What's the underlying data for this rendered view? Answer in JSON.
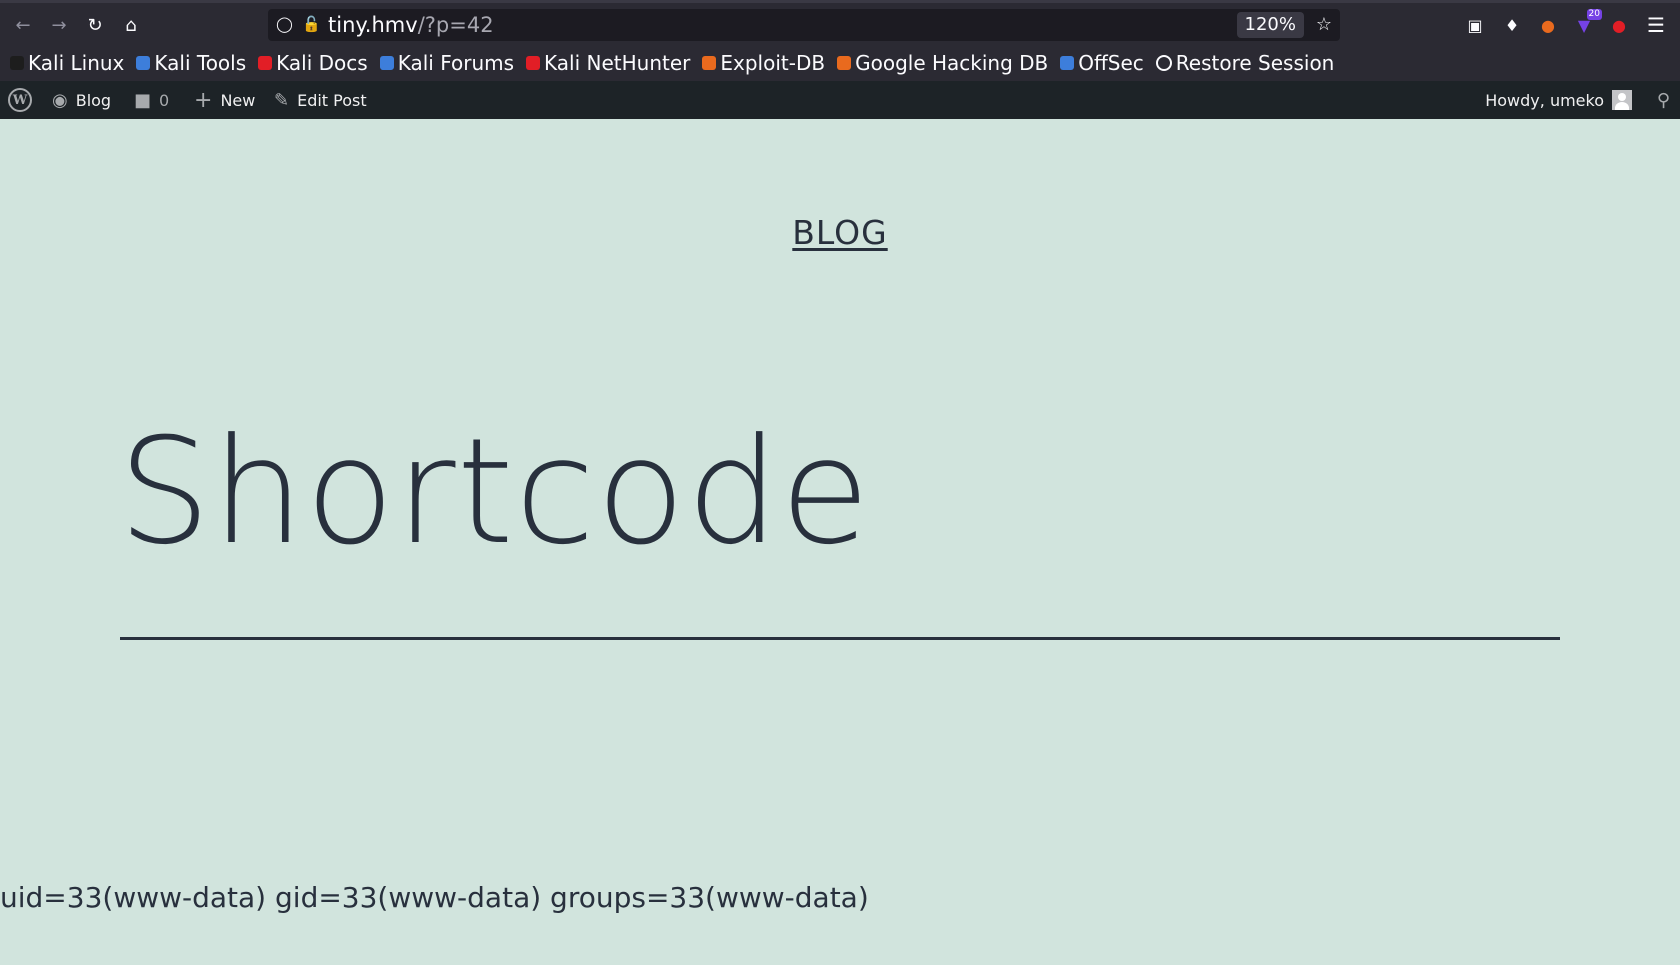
{
  "browser": {
    "url_domain": "tiny.hmv",
    "url_path": "/?p=42",
    "zoom": "120%",
    "extension_badge": "20"
  },
  "bookmarks": [
    {
      "label": "Kali Linux",
      "color": "#1d1d1d"
    },
    {
      "label": "Kali Tools",
      "color": "#3d7edb"
    },
    {
      "label": "Kali Docs",
      "color": "#e21e26"
    },
    {
      "label": "Kali Forums",
      "color": "#3d7edb"
    },
    {
      "label": "Kali NetHunter",
      "color": "#e21e26"
    },
    {
      "label": "Exploit-DB",
      "color": "#e96a1e"
    },
    {
      "label": "Google Hacking DB",
      "color": "#e96a1e"
    },
    {
      "label": "OffSec",
      "color": "#3d7edb"
    },
    {
      "label": "Restore Session",
      "color": "#fbfbfe"
    }
  ],
  "adminbar": {
    "site": "Blog",
    "comments": "0",
    "new": "New",
    "edit": "Edit Post",
    "howdy": "Howdy, umeko"
  },
  "page": {
    "site_title": "BLOG",
    "post_title": "Shortcode",
    "output": "uid=33(www-data) gid=33(www-data) groups=33(www-data)"
  }
}
